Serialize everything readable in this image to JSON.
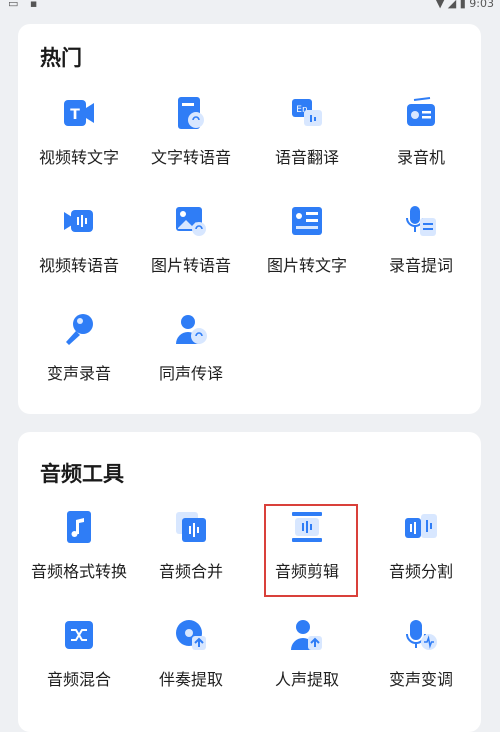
{
  "status_bar": {
    "left_icons": "▭ ▪",
    "right_text": "▼ ◢ ▮ 9:03"
  },
  "colors": {
    "icon_blue": "#2f7df6",
    "icon_light": "#d8e7ff",
    "highlight_border": "#d9403a"
  },
  "hot": {
    "title": "热门",
    "items": [
      {
        "label": "视频转文字",
        "icon": "video-to-text-icon"
      },
      {
        "label": "文字转语音",
        "icon": "text-to-speech-icon"
      },
      {
        "label": "语音翻译",
        "icon": "voice-translate-icon"
      },
      {
        "label": "录音机",
        "icon": "recorder-icon"
      },
      {
        "label": "视频转语音",
        "icon": "video-to-audio-icon"
      },
      {
        "label": "图片转语音",
        "icon": "image-to-speech-icon"
      },
      {
        "label": "图片转文字",
        "icon": "image-to-text-icon"
      },
      {
        "label": "录音提词",
        "icon": "teleprompter-icon"
      },
      {
        "label": "变声录音",
        "icon": "voice-change-record-icon"
      },
      {
        "label": "同声传译",
        "icon": "simultaneous-interpretation-icon"
      }
    ]
  },
  "audio_tools": {
    "title": "音频工具",
    "items": [
      {
        "label": "音频格式转换",
        "icon": "audio-format-convert-icon"
      },
      {
        "label": "音频合并",
        "icon": "audio-merge-icon"
      },
      {
        "label": "音频剪辑",
        "icon": "audio-cut-icon"
      },
      {
        "label": "音频分割",
        "icon": "audio-split-icon"
      },
      {
        "label": "音频混合",
        "icon": "audio-mix-icon"
      },
      {
        "label": "伴奏提取",
        "icon": "accompaniment-extract-icon"
      },
      {
        "label": "人声提取",
        "icon": "vocal-extract-icon"
      },
      {
        "label": "变声变调",
        "icon": "voice-pitch-change-icon"
      }
    ]
  }
}
